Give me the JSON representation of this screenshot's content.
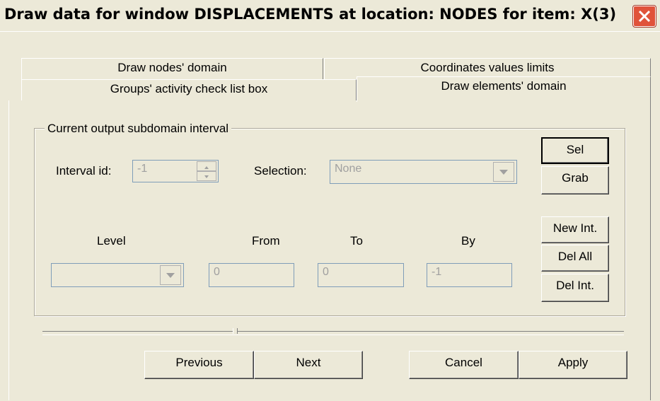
{
  "window": {
    "title": "Draw data for window DISPLACEMENTS at location: NODES for item: X(3)"
  },
  "tabs": {
    "row1": [
      "Draw nodes' domain",
      "Coordinates values limits"
    ],
    "row2": [
      "Groups' activity check list box",
      "Draw elements' domain"
    ],
    "active": "Draw elements' domain"
  },
  "group": {
    "legend": "Current output subdomain interval",
    "interval_id_label": "Interval id:",
    "interval_id_value": "-1",
    "selection_label": "Selection:",
    "selection_value": "None",
    "level_label": "Level",
    "level_value": "",
    "from_label": "From",
    "from_value": "0",
    "to_label": "To",
    "to_value": "0",
    "by_label": "By",
    "by_value": "-1"
  },
  "side_buttons": {
    "sel": "Sel",
    "grab": "Grab",
    "new_int": "New Int.",
    "del_all": "Del All",
    "del_int": "Del Int."
  },
  "progress": {
    "fraction": 0.33
  },
  "footer": {
    "previous": "Previous",
    "next": "Next",
    "cancel": "Cancel",
    "apply": "Apply"
  }
}
